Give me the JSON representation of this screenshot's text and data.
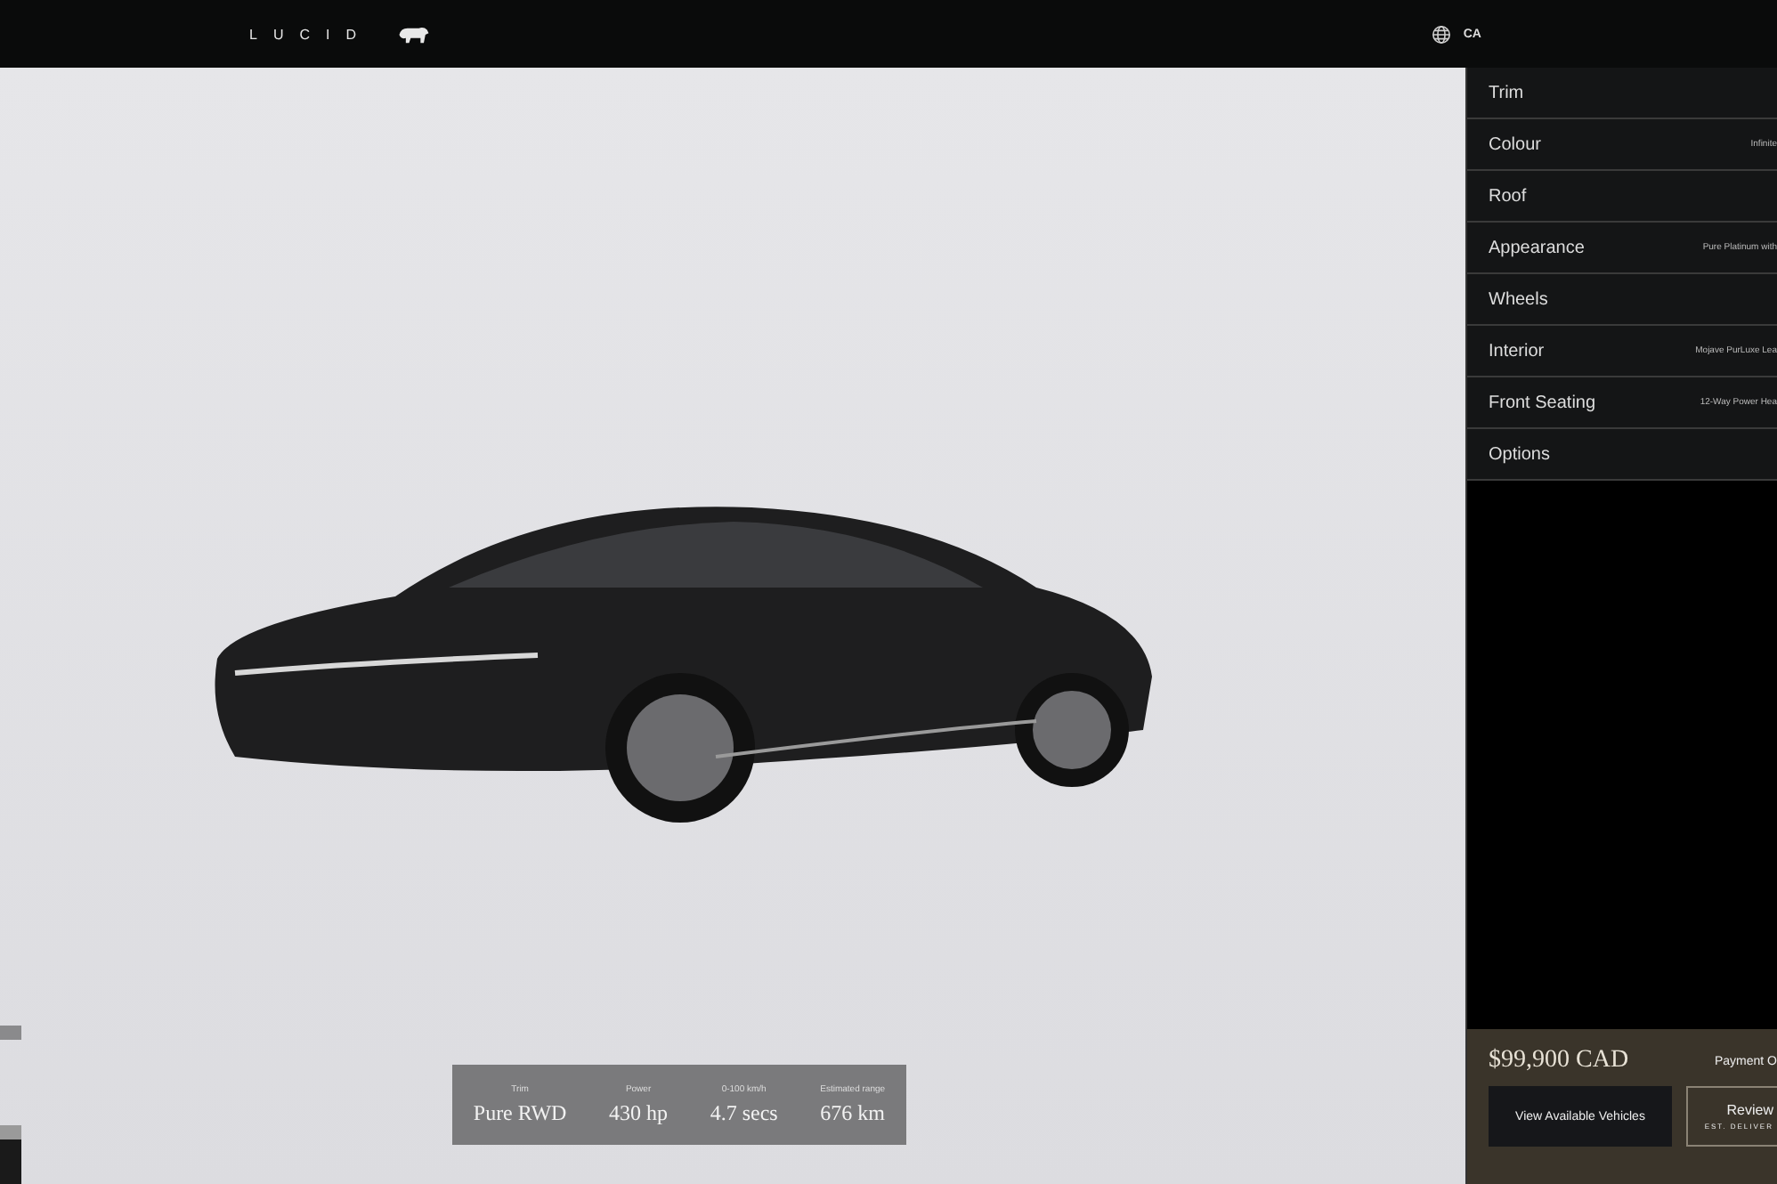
{
  "header": {
    "logo": "LUCID",
    "region": "CA"
  },
  "configurator": {
    "sections": [
      {
        "label": "Trim"
      },
      {
        "label": "Colour",
        "value": "Infinite"
      },
      {
        "label": "Roof"
      },
      {
        "label": "Appearance",
        "value": "Pure Platinum with"
      },
      {
        "label": "Wheels"
      },
      {
        "label": "Interior",
        "value": "Mojave PurLuxe Lea"
      },
      {
        "label": "Front Seating",
        "value": "12-Way Power Hea"
      },
      {
        "label": "Options"
      }
    ]
  },
  "specs": [
    {
      "label": "Trim",
      "value": "Pure RWD"
    },
    {
      "label": "Power",
      "value": "430 hp"
    },
    {
      "label": "0-100 km/h",
      "value": "4.7 secs"
    },
    {
      "label": "Estimated range",
      "value": "676 km"
    }
  ],
  "summary": {
    "price": "$99,900 CAD",
    "payment": "Payment O",
    "primary_button": "View Available Vehicles",
    "secondary_button": "Review",
    "secondary_note": "EST. DELIVER"
  }
}
